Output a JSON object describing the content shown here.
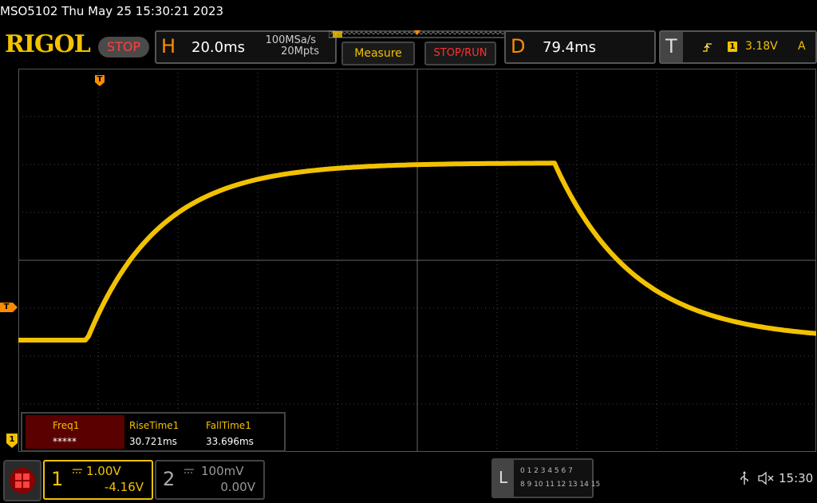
{
  "status_line": "MSO5102  Thu May 25 15:30:21 2023",
  "brand": "RIGOL",
  "run_state": "STOP",
  "horizontal": {
    "letter": "H",
    "timebase": "20.0ms",
    "sample_rate": "100MSa/s",
    "memory_depth": "20Mpts"
  },
  "buttons": {
    "measure": "Measure",
    "stop_run": "STOP/RUN"
  },
  "delay": {
    "letter": "D",
    "value": "79.4ms"
  },
  "trigger": {
    "letter": "T",
    "channel": "1",
    "level": "3.18V",
    "coupling": "A"
  },
  "markers": {
    "trigger_pos": "T",
    "trigger_level": "T",
    "ch1_ground": "1"
  },
  "measurements": [
    {
      "label": "Freq1",
      "value": "*****"
    },
    {
      "label": "RiseTime1",
      "value": "30.721ms"
    },
    {
      "label": "FallTime1",
      "value": "33.696ms"
    }
  ],
  "channel1": {
    "number": "1",
    "scale": "1.00V",
    "offset": "-4.16V"
  },
  "channel2": {
    "number": "2",
    "scale": "100mV",
    "offset": "0.00V"
  },
  "logic": {
    "letter": "L",
    "row1": "0 1 2 3  4 5 6 7",
    "row2": "8 9 10 11 12 13 14 15"
  },
  "system": {
    "time": "15:30"
  },
  "colors": {
    "ch1": "#f2c200",
    "accent": "#ff8c00",
    "stop": "#ff3030"
  },
  "icons": [
    "usb-icon",
    "mute-icon",
    "menu-grid-icon"
  ]
}
